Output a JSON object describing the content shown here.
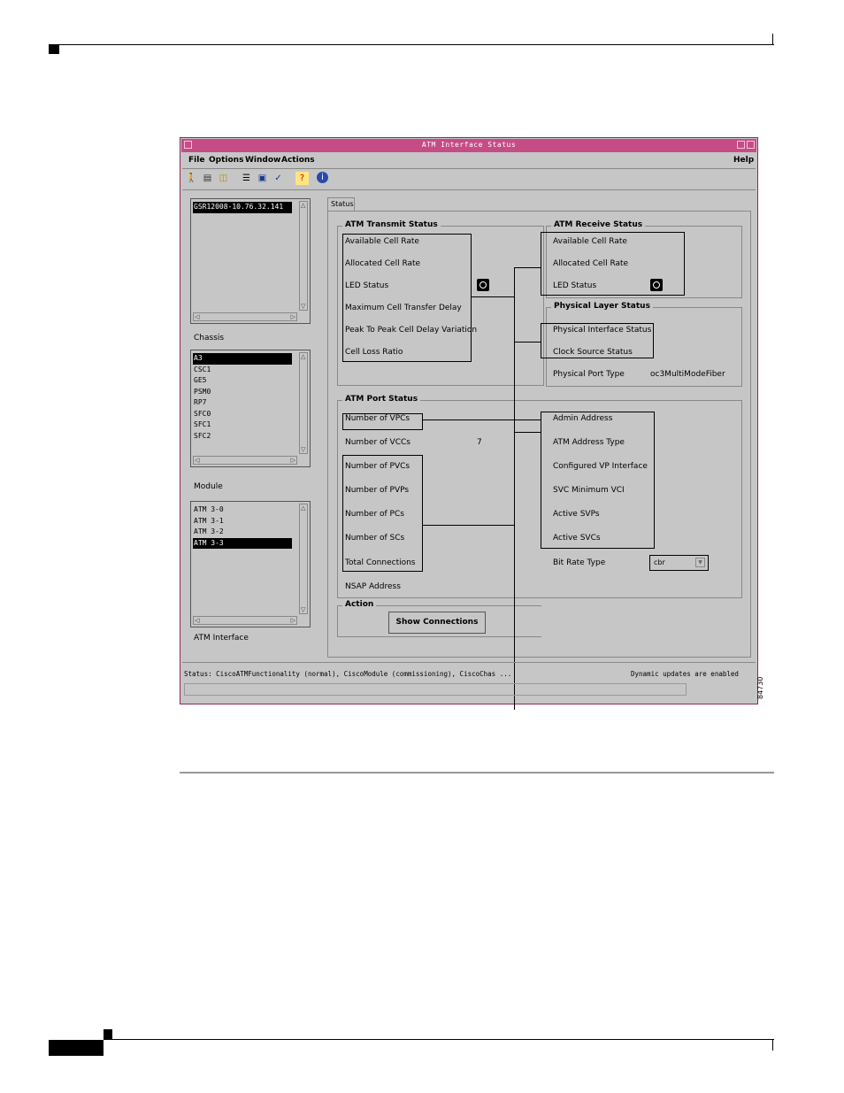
{
  "window": {
    "title": "ATM Interface Status",
    "menus": [
      "File",
      "Options",
      "Window",
      "Actions"
    ],
    "help_menu": "Help",
    "toolbar_icons": [
      "exit-icon",
      "print-icon",
      "open-folder-icon",
      "list-icon",
      "monitor-icon",
      "check-icon",
      "help-icon",
      "info-icon"
    ]
  },
  "left_panel": {
    "chassis_items": [
      "GSR12008-10.76.32.141"
    ],
    "chassis_label": "Chassis",
    "module_items": [
      "A3",
      "CSC1",
      "GE5",
      "PSM0",
      "RP7",
      "SFC0",
      "SFC1",
      "SFC2"
    ],
    "module_label": "Module",
    "interface_items": [
      "ATM 3-0",
      "ATM 3-1",
      "ATM 3-2",
      "ATM 3-3"
    ],
    "interface_label": "ATM Interface"
  },
  "tab": "Status",
  "transmit": {
    "title": "ATM Transmit Status",
    "fields": [
      "Available Cell Rate",
      "Allocated Cell Rate",
      "LED Status",
      "Maximum Cell Transfer Delay",
      "Peak To Peak Cell Delay Variation",
      "Cell Loss Ratio"
    ]
  },
  "receive": {
    "title": "ATM Receive Status",
    "fields": [
      "Available Cell Rate",
      "Allocated Cell Rate",
      "LED Status"
    ]
  },
  "physical": {
    "title": "Physical Layer Status",
    "fields": [
      "Physical Interface Status",
      "Clock Source Status"
    ],
    "port_type_label": "Physical Port Type",
    "port_type_value": "oc3MultiModeFiber"
  },
  "port": {
    "title": "ATM Port Status",
    "vpcs": "Number of VPCs",
    "vccs": "Number of VCCs",
    "vccs_value": "7",
    "left_fields": [
      "Number of PVCs",
      "Number of PVPs",
      "Number of PCs",
      "Number of SCs",
      "Total Connections"
    ],
    "nsap": "NSAP Address",
    "right_fields": [
      "Admin Address",
      "ATM Address Type",
      "Configured VP Interface",
      "SVC Minimum VCI",
      "Active SVPs",
      "Active SVCs"
    ],
    "bit_rate_label": "Bit Rate Type",
    "bit_rate_value": "cbr"
  },
  "action": {
    "title": "Action",
    "button": "Show Connections"
  },
  "statusbar": {
    "status": "Status: CiscoATMFunctionality (normal), CiscoModule (commissioning), CiscoChas ...",
    "updates": "Dynamic updates are enabled"
  },
  "figure_number": "84730"
}
